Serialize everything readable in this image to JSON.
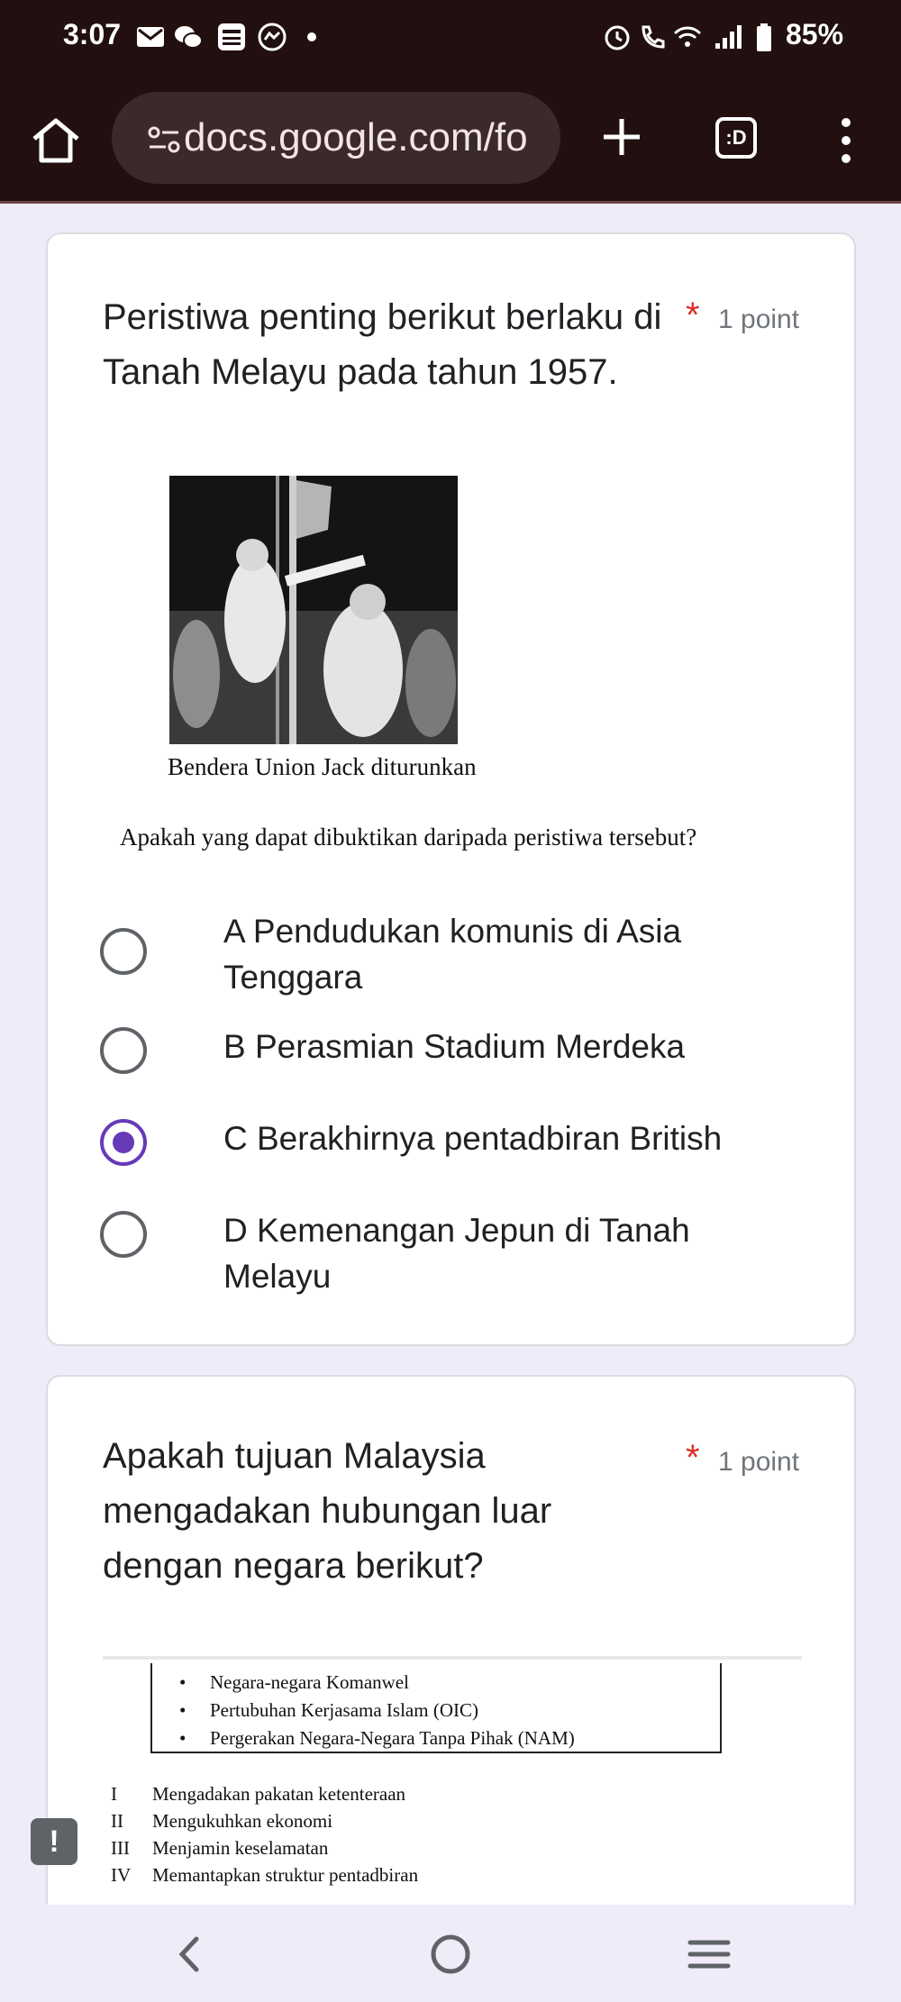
{
  "status_bar": {
    "time": "3:07",
    "battery": "85%",
    "icons": [
      "gmail-icon",
      "wechat-icon",
      "touch-n-go-icon",
      "messenger-icon",
      "dot-icon",
      "alarm-icon",
      "wifi-call-icon",
      "wifi-icon",
      "signal-icon",
      "battery-icon"
    ]
  },
  "browser": {
    "url": "docs.google.com/fo",
    "tab_switcher_label": ":D",
    "icons": [
      "home-icon",
      "site-settings-icon",
      "new-tab-icon",
      "tab-switcher-icon",
      "more-menu-icon"
    ]
  },
  "question1": {
    "title": "Peristiwa penting berikut berlaku di Tanah Melayu pada tahun 1957.",
    "required_mark": "*",
    "points": "1 point",
    "image_caption": "Bendera Union Jack diturunkan",
    "sub_question": "Apakah yang dapat dibuktikan daripada peristiwa tersebut?",
    "options": [
      {
        "label": "A Pendudukan komunis di Asia Tenggara",
        "selected": false
      },
      {
        "label": "B Perasmian Stadium Merdeka",
        "selected": false
      },
      {
        "label": "C Berakhirnya pentadbiran British",
        "selected": true
      },
      {
        "label": "D Kemenangan Jepun di Tanah Melayu",
        "selected": false
      }
    ]
  },
  "question2": {
    "title": "Apakah tujuan Malaysia mengadakan hubungan luar dengan negara berikut?",
    "required_mark": "*",
    "points": "1 point",
    "box_items": [
      "Negara-negara Komanwel",
      "Pertubuhan Kerjasama Islam (OIC)",
      "Pergerakan Negara-Negara Tanpa Pihak (NAM)"
    ],
    "bullet": "•",
    "statements": [
      {
        "num": "I",
        "text": "Mengadakan pakatan ketenteraan"
      },
      {
        "num": "II",
        "text": "Mengukuhkan ekonomi"
      },
      {
        "num": "III",
        "text": "Menjamin keselamatan"
      },
      {
        "num": "IV",
        "text": "Memantapkan struktur pentadbiran"
      }
    ]
  },
  "feedback_button": "!",
  "colors": {
    "background": "#f0ebf8",
    "accent": "#673ab7",
    "required": "#d93025",
    "toolbar": "#221010"
  },
  "nav_icons": [
    "back-icon",
    "home-circle-icon",
    "recents-icon"
  ]
}
